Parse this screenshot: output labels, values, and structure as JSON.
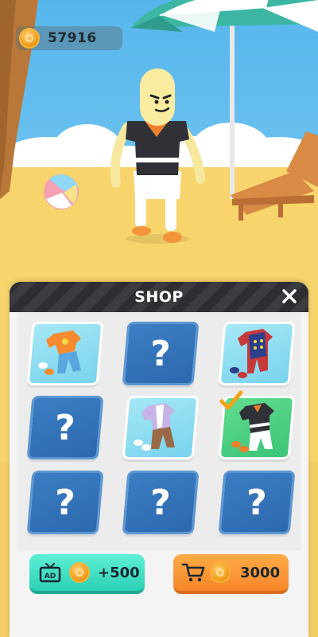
{
  "hud": {
    "coins": "57916",
    "coin_icon": "coin-icon"
  },
  "shop": {
    "title": "SHOP",
    "close_icon": "close-icon",
    "items": [
      {
        "state": "owned",
        "outfit": "orange-yellow-overalls"
      },
      {
        "state": "locked",
        "label": "?"
      },
      {
        "state": "owned",
        "outfit": "red-blue-soldier-suit"
      },
      {
        "state": "locked",
        "label": "?"
      },
      {
        "state": "owned",
        "outfit": "lavender-shirt-brown-pants"
      },
      {
        "state": "selected",
        "outfit": "black-jersey-white-shorts",
        "check_icon": "checkmark-icon"
      },
      {
        "state": "locked",
        "label": "?"
      },
      {
        "state": "locked",
        "label": "?"
      },
      {
        "state": "locked",
        "label": "?"
      }
    ],
    "watch_ad_button": {
      "label": "+500",
      "icons": [
        "ad-tv-icon",
        "coin-icon"
      ]
    },
    "buy_button": {
      "label": "3000",
      "icons": [
        "cart-icon",
        "coin-icon"
      ]
    }
  },
  "colors": {
    "sky": "#7fd0f5",
    "sand": "#f8d870",
    "locked_card": "#3772b8",
    "owned_card": "#8fdcf2",
    "selected_card": "#4fd184",
    "ad_button": "#3cdcc0",
    "buy_button": "#f9962f",
    "header": "#333337"
  }
}
